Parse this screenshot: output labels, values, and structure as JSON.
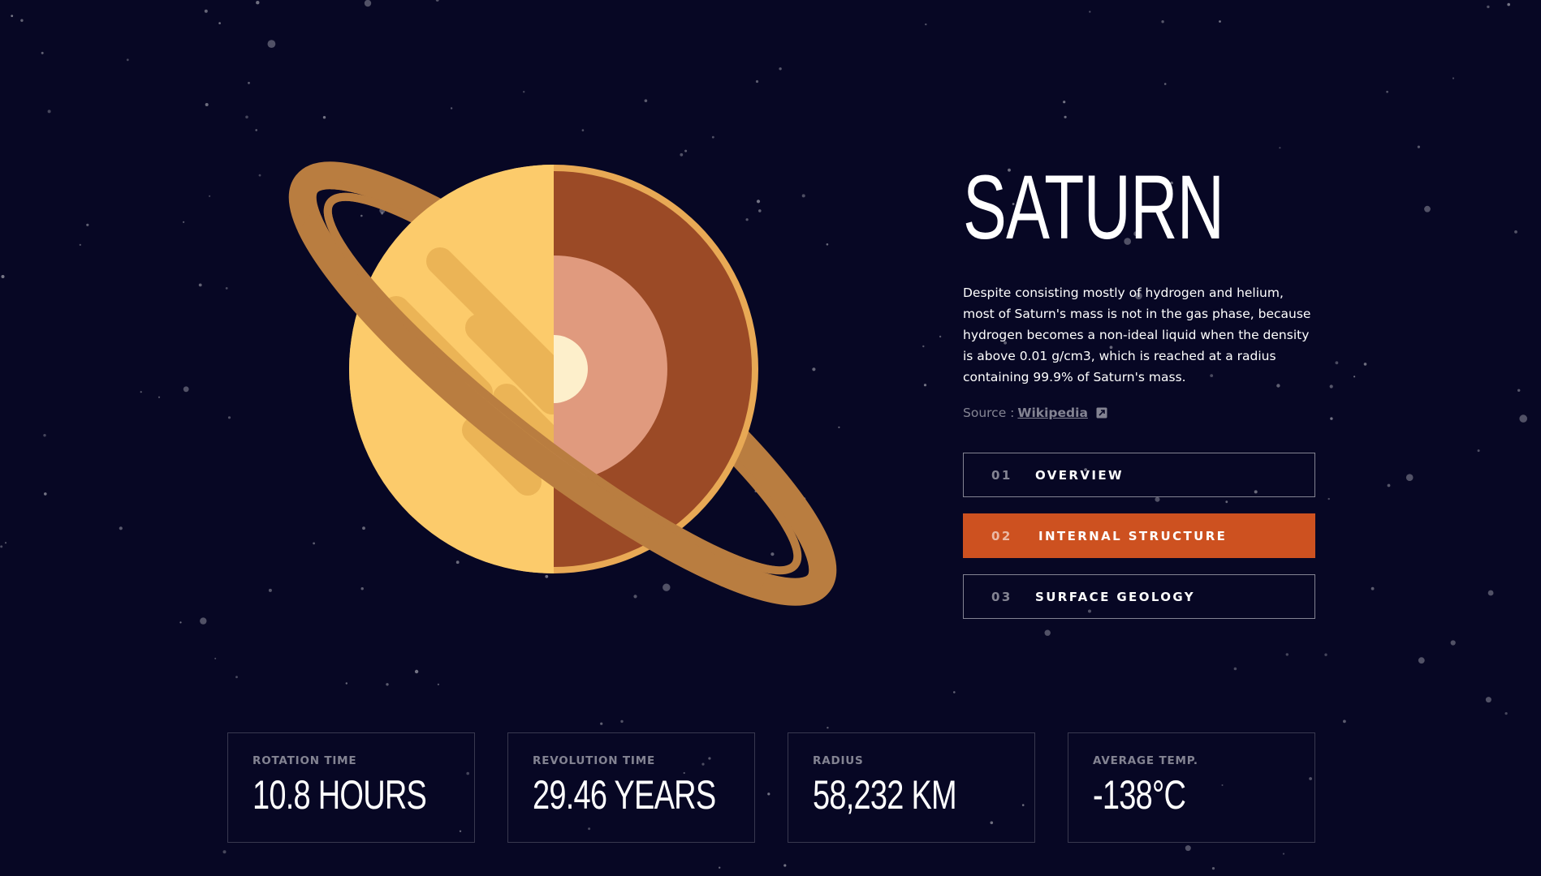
{
  "planet": {
    "name": "SATURN",
    "description": "Despite consisting mostly of hydrogen and helium, most of Saturn's mass is not in the gas phase, because hydrogen becomes a non-ideal liquid when the density is above 0.01 g/cm3, which is reached at a radius containing 99.9% of Saturn's mass.",
    "source_prefix": "Source :",
    "source_link": "Wikipedia",
    "source_icon": "external-link-icon"
  },
  "tabs": [
    {
      "number": "01",
      "label": "OVERVIEW",
      "active": false
    },
    {
      "number": "02",
      "label": "INTERNAL STRUCTURE",
      "active": true
    },
    {
      "number": "03",
      "label": "SURFACE GEOLOGY",
      "active": false
    }
  ],
  "stats": [
    {
      "label": "ROTATION TIME",
      "value": "10.8 HOURS"
    },
    {
      "label": "REVOLUTION TIME",
      "value": "29.46 YEARS"
    },
    {
      "label": "RADIUS",
      "value": "58,232 KM"
    },
    {
      "label": "AVERAGE TEMP.",
      "value": "-138°C"
    }
  ],
  "colors": {
    "background": "#070724",
    "accent": "#CD5120",
    "planet_surface": "#FCCB6B",
    "planet_bands": "#EBB456",
    "mantle": "#9B4A26",
    "core_outer": "#E09A7E",
    "core_inner": "#FDEFCB",
    "ring": "#B97D40"
  }
}
